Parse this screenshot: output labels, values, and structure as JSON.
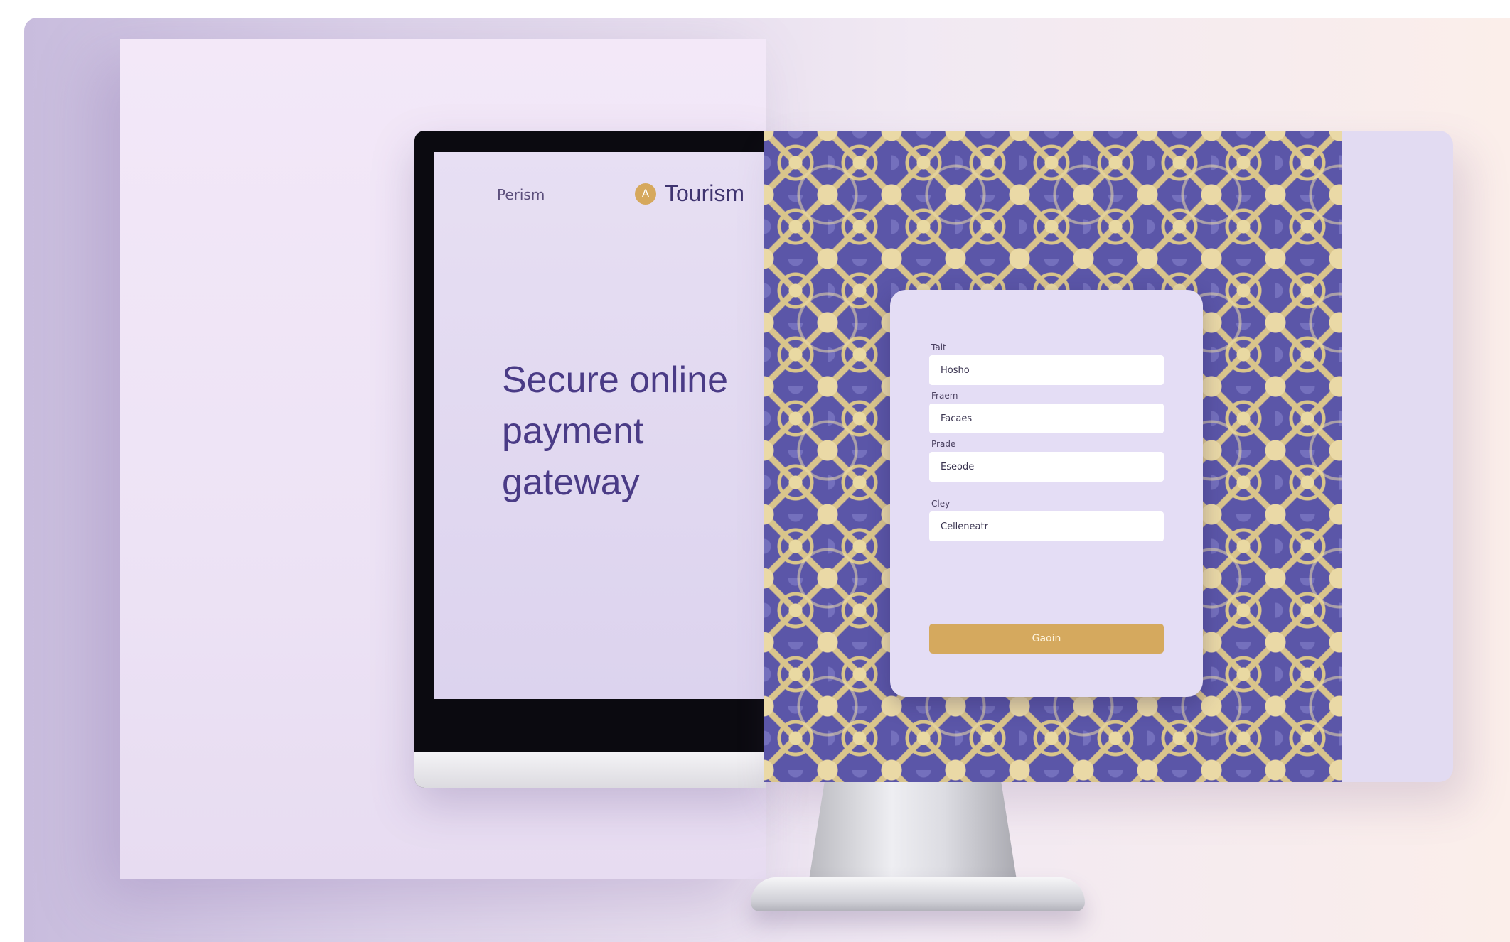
{
  "left_screen": {
    "brand_small": "Perism",
    "brand_name": "Tourism",
    "logo_glyph": "A",
    "headline": "Secure online payment gateway"
  },
  "form": {
    "fields": [
      {
        "label": "Tait",
        "value": "Hosho"
      },
      {
        "label": "Fraem",
        "value": "Facaes"
      },
      {
        "label": "Prade",
        "value": "Eseode"
      },
      {
        "label": "Cley",
        "value": "Celleneatr"
      }
    ],
    "submit_label": "Gaoin"
  },
  "colors": {
    "headline": "#4a3b86",
    "accent_gold": "#d5a95e",
    "pattern_blue": "#5b56a8",
    "pattern_cream": "#e9d9a2",
    "card_bg": "#e4ddf5"
  },
  "icons": {
    "logo": "gold-circle-logo-icon"
  }
}
